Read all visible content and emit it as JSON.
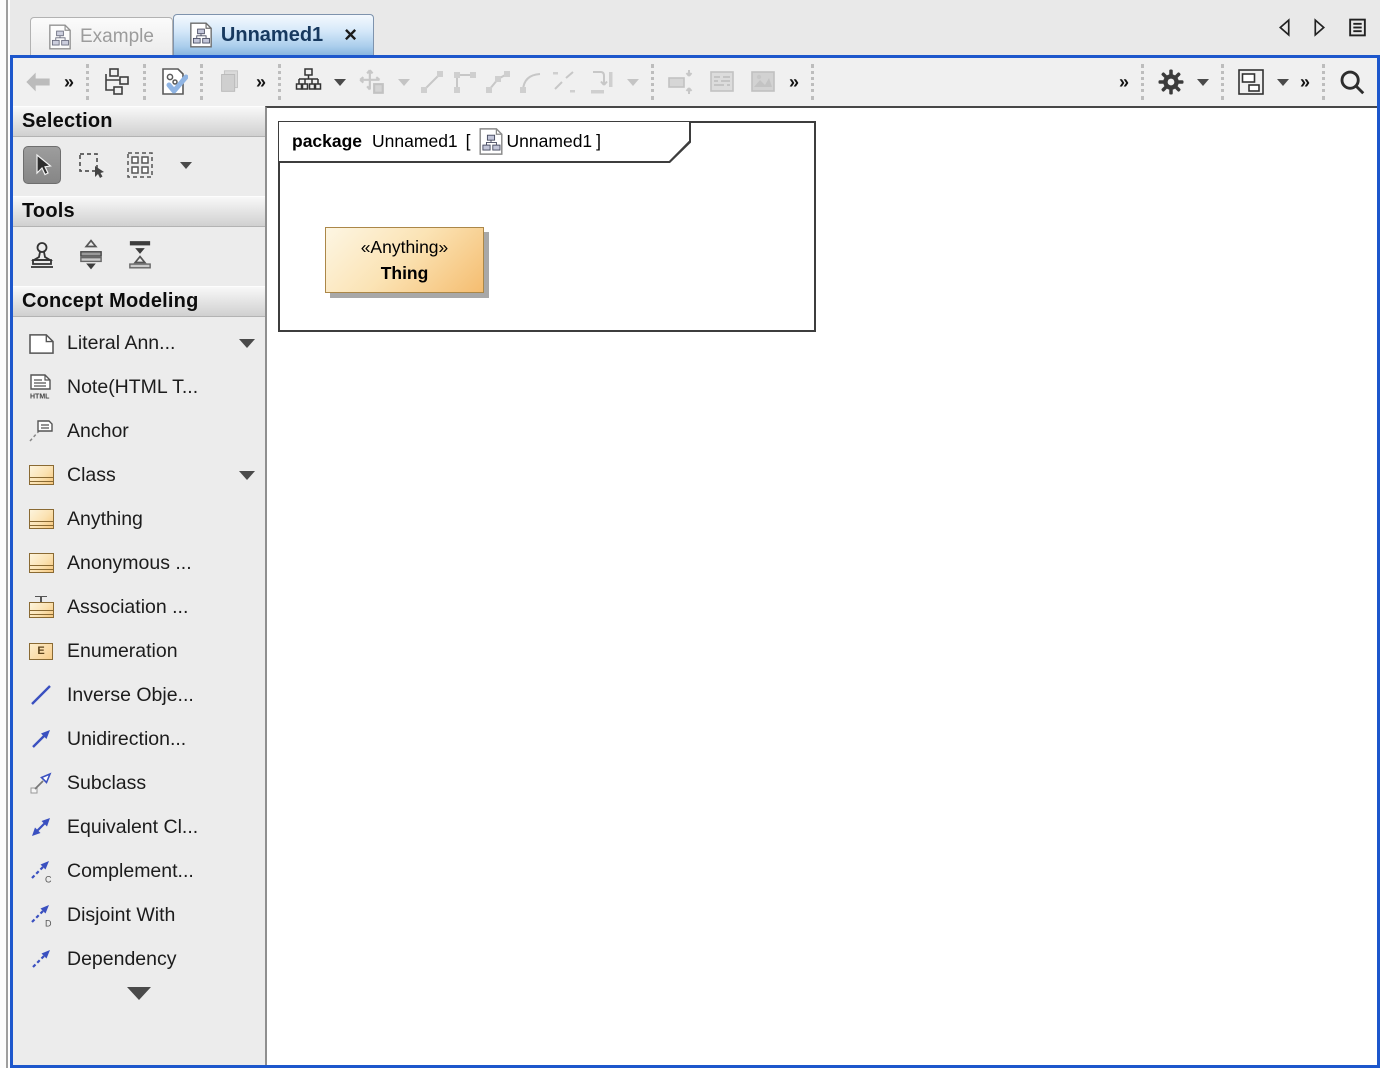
{
  "window": {
    "tabs": [
      {
        "label": "Example"
      },
      {
        "label": "Unnamed1",
        "close_glyph": "×"
      }
    ]
  },
  "toolbar": {
    "overflow_glyph": "»"
  },
  "sidebar": {
    "selection_title": "Selection",
    "tools_title": "Tools",
    "concept_title": "Concept Modeling",
    "items": [
      "Literal Ann...",
      "Note(HTML T...",
      "Anchor",
      "Class",
      "Anything",
      "Anonymous ...",
      "Association ...",
      "Enumeration",
      "Inverse Obje...",
      "Unidirection...",
      "Subclass",
      "Equivalent Cl...",
      "Complement...",
      "Disjoint With",
      "Dependency"
    ]
  },
  "canvas": {
    "package_keyword": "package",
    "package_name": "Unnamed1",
    "bracket_open": "[",
    "diagram_name": "Unnamed1",
    "bracket_close": "]",
    "thing_stereotype": "«Anything»",
    "thing_name": "Thing"
  },
  "icons": {
    "note_html_label": "HTML",
    "enumeration_letter": "E",
    "complement_letter": "C",
    "disjoint_letter": "D"
  },
  "colors": {
    "focus_border": "#1d57cc",
    "class_fill_light": "#fdf5e0",
    "class_fill_dark": "#f5bd70",
    "class_border": "#ab8748",
    "relation_blue": "#3a50c0"
  }
}
